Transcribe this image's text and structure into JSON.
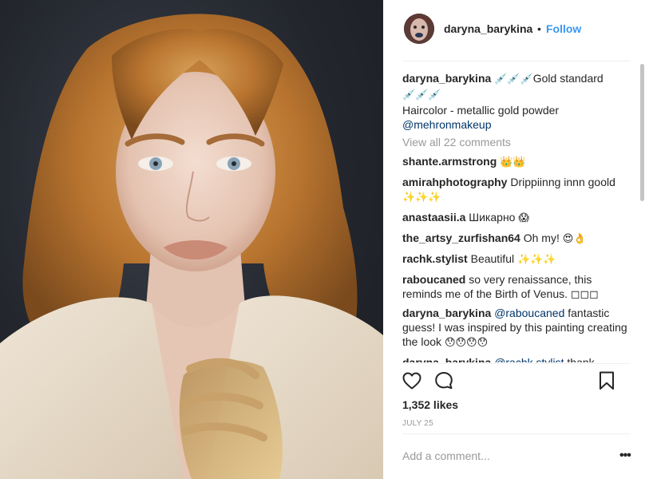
{
  "header": {
    "username": "daryna_barykina",
    "dot": "•",
    "follow_label": "Follow"
  },
  "caption": {
    "username": "daryna_barykina",
    "emoji_lead": "💉💉💉",
    "line1": "Gold standard",
    "emoji_trail": "💉💉💉",
    "line2": "Haircolor - metallic gold powder",
    "mention": "@mehronmakeup"
  },
  "view_all": "View all 22 comments",
  "comments": [
    {
      "user": "shante.armstrong",
      "text": "",
      "emoji": "👑👑"
    },
    {
      "user": "amirahphotography",
      "text": "Drippiinng innn goold",
      "emoji": "✨✨✨"
    },
    {
      "user": "anastaasii.a",
      "text": "Шикарно",
      "emoji": "😱"
    },
    {
      "user": "the_artsy_zurfishan64",
      "text": "Oh my!",
      "emoji": "😍👌"
    },
    {
      "user": "rachk.stylist",
      "text": "Beautiful",
      "emoji": "✨✨✨"
    },
    {
      "user": "raboucaned",
      "text": "so very renaissance, this reminds me of the Birth of Venus. ◻◻◻",
      "emoji": ""
    },
    {
      "user": "daryna_barykina",
      "mention": "@raboucaned",
      "text": "fantastic guess! I was inspired by this painting creating the look",
      "emoji": "😯😯😯😯"
    },
    {
      "user": "daryna_barykina",
      "mention": "@rachk.stylist",
      "text": "thank",
      "emoji": ""
    }
  ],
  "likes": "1,352 likes",
  "date": "JULY 25",
  "add_comment_placeholder": "Add a comment...",
  "more_label": "•••",
  "icons": {
    "like": "heart-icon",
    "comment": "comment-icon",
    "save": "bookmark-icon",
    "more": "more-options-icon"
  },
  "colors": {
    "follow": "#3897f0",
    "mention": "#003569",
    "muted": "#999999",
    "text": "#262626"
  }
}
